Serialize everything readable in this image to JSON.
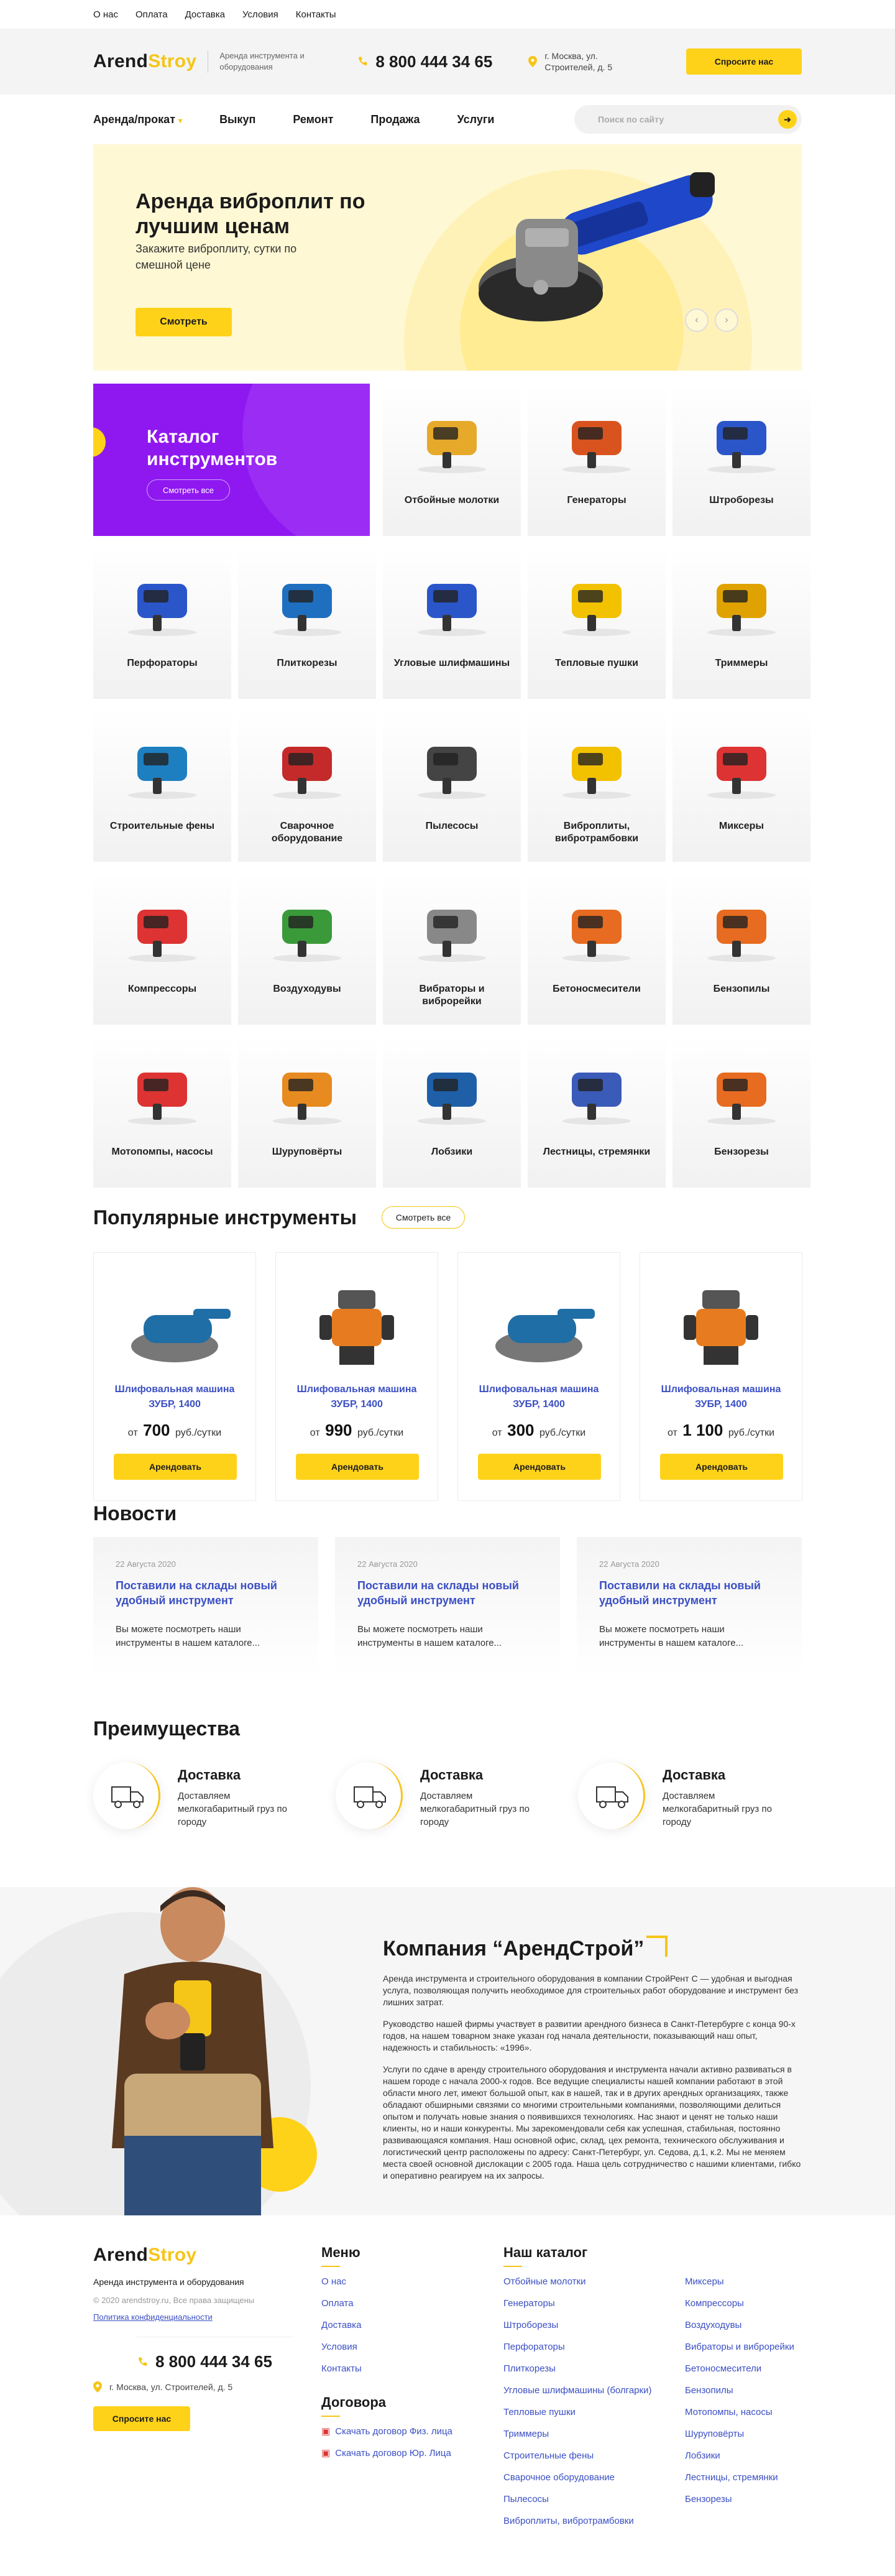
{
  "top_nav": [
    "О нас",
    "Оплата",
    "Доставка",
    "Условия",
    "Контакты"
  ],
  "header": {
    "logo_a": "Arend",
    "logo_b": "Stroy",
    "tagline": "Аренда инструмента и оборудования",
    "phone": "8 800 444 34 65",
    "address": "г. Москва, ул. Строителей, д. 5",
    "ask_button": "Спросите нас"
  },
  "main_nav": [
    "Аренда/прокат",
    "Выкуп",
    "Ремонт",
    "Продажа",
    "Услуги"
  ],
  "search": {
    "placeholder": "Поиск по сайту"
  },
  "hero": {
    "title": "Аренда виброплит по лучшим ценам",
    "subtitle": "Закажите виброплиту, сутки по смешной цене",
    "cta": "Смотреть"
  },
  "catalog": {
    "title": "Каталог инструментов",
    "see_all": "Смотреть все",
    "items": [
      "Отбойные молотки",
      "Генераторы",
      "Штроборезы",
      "Перфораторы",
      "Плиткорезы",
      "Угловые шлифмашины",
      "Тепловые пушки",
      "Триммеры",
      "Строительные фены",
      "Сварочное оборудование",
      "Пылесосы",
      "Виброплиты, вибротрамбовки",
      "Миксеры",
      "Компрессоры",
      "Воздуходувы",
      "Вибраторы и виброрейки",
      "Бетоносмесители",
      "Бензопилы",
      "Мотопомпы, насосы",
      "Шуруповёрты",
      "Лобзики",
      "Лестницы, стремянки",
      "Бензорезы"
    ]
  },
  "popular": {
    "title": "Популярные инструменты",
    "see_all": "Смотреть все",
    "price_from": "от",
    "price_unit": "руб./сутки",
    "rent_button": "Арендовать",
    "products": [
      {
        "name": "Шлифовальная машина ЗУБР, 1400",
        "price": "700"
      },
      {
        "name": "Шлифовальная машина ЗУБР, 1400",
        "price": "990"
      },
      {
        "name": "Шлифовальная машина ЗУБР, 1400",
        "price": "300"
      },
      {
        "name": "Шлифовальная машина ЗУБР, 1400",
        "price": "1 100"
      }
    ]
  },
  "news": {
    "title": "Новости",
    "items": [
      {
        "date": "22 Августа 2020",
        "title": "Поставили на склады новый удобный инструмент",
        "text": "Вы можете посмотреть наши инструменты в нашем каталоге..."
      },
      {
        "date": "22 Августа 2020",
        "title": "Поставили на склады новый удобный инструмент",
        "text": "Вы можете посмотреть наши инструменты в нашем каталоге..."
      },
      {
        "date": "22 Августа 2020",
        "title": "Поставили на склады новый удобный инструмент",
        "text": "Вы можете посмотреть наши инструменты в нашем каталоге..."
      }
    ]
  },
  "advantages": {
    "title": "Преимущества",
    "items": [
      {
        "title": "Доставка",
        "text": "Доставляем мелкогабаритный груз по городу"
      },
      {
        "title": "Доставка",
        "text": "Доставляем мелкогабаритный груз по городу"
      },
      {
        "title": "Доставка",
        "text": "Доставляем мелкогабаритный груз по городу"
      }
    ]
  },
  "about": {
    "title": "Компания “АрендСтрой”",
    "p1": "Аренда инструмента и строительного оборудования в компании СтройРент С — удобная и выгодная услуга, позволяющая получить необходимое для строительных работ оборудование и инструмент без лишних затрат.",
    "p2": "Руководство нашей фирмы участвует в развитии арендного бизнеса в Санкт-Петербурге с конца 90-х годов, на нашем товарном знаке указан год начала деятельности, показывающий наш опыт, надежность и стабильность: «1996».",
    "p3": "Услуги по сдаче в аренду строительного оборудования и инструмента начали активно развиваться в нашем городе с начала 2000-х годов. Все ведущие специалисты нашей компании работают в этой области много лет, имеют большой опыт, как в нашей, так и в других арендных организациях, также обладают обширными связями со многими строительными компаниями, позволяющими делиться опытом и получать новые знания о появившихся технологиях. Нас знают и ценят не только наши клиенты, но и наши конкуренты. Мы зарекомендовали себя как успешная, стабильная, постоянно развивающаяся компания. Наш основной офис, склад, цех ремонта, технического обслуживания и логистический центр расположены по адресу: Санкт-Петербург, ул. Седова, д.1, к.2. Мы не меняем места своей основной дислокации с 2005 года. Наша цель сотрудничество с нашими клиентами, гибко и оперативно реагируем на их запросы."
  },
  "footer": {
    "tagline": "Аренда инструмента и оборудования",
    "copyright": "© 2020 arendstroy.ru, Все права защищены",
    "privacy": "Политика конфиденциальности",
    "menu_title": "Меню",
    "menu": [
      "О нас",
      "Оплата",
      "Доставка",
      "Условия",
      "Контакты"
    ],
    "contracts_title": "Договора",
    "contracts": [
      "Скачать договор Физ. лица",
      "Скачать договор Юр. Лица"
    ],
    "catalog_title": "Наш каталог",
    "catalog_col1": [
      "Отбойные молотки",
      "Генераторы",
      "Штроборезы",
      "Перфораторы",
      "Плиткорезы",
      "Угловые шлифмашины (болгарки)",
      "Тепловые пушки",
      "Триммеры",
      "Строительные фены",
      "Сварочное оборудование",
      "Пылесосы",
      "Виброплиты, вибротрамбовки"
    ],
    "catalog_col2": [
      "Миксеры",
      "Компрессоры",
      "Воздуходувы",
      "Вибраторы и виброрейки",
      "Бетоносмесители",
      "Бензопилы",
      "Мотопомпы, насосы",
      "Шуруповёрты",
      "Лобзики",
      "Лестницы, стремянки",
      "Бензорезы"
    ]
  },
  "colors": {
    "accent": "#ffd21a",
    "purple": "#8f18f0",
    "link": "#3b4fc4"
  }
}
